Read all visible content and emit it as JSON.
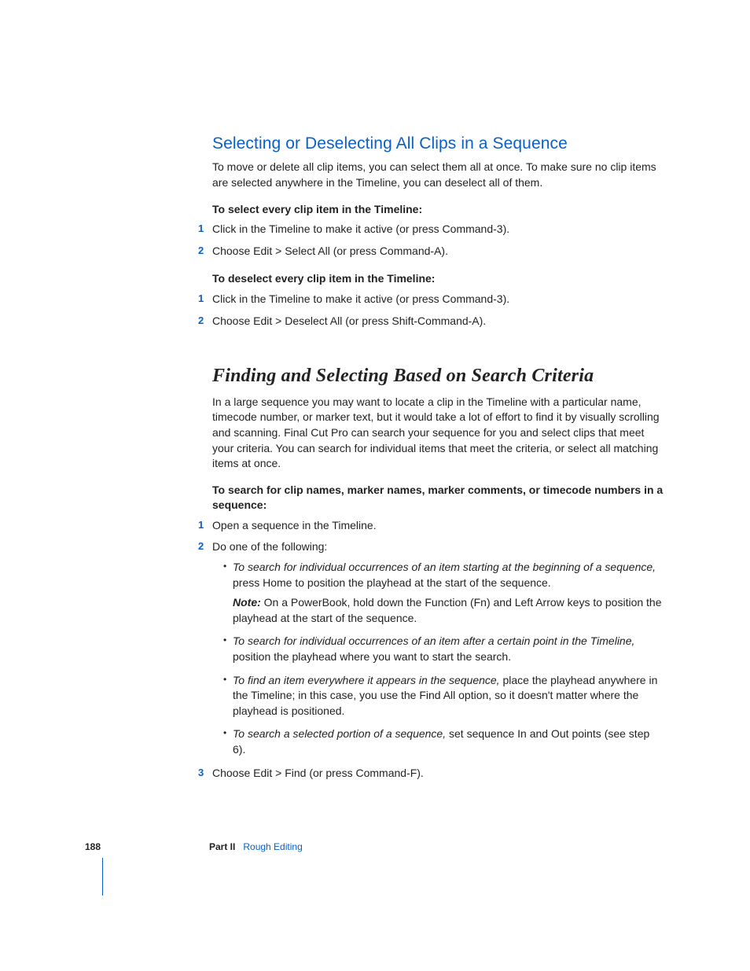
{
  "section1": {
    "heading": "Selecting or Deselecting All Clips in a Sequence",
    "intro": "To move or delete all clip items, you can select them all at once. To make sure no clip items are selected anywhere in the Timeline, you can deselect all of them.",
    "sub1": "To select every clip item in the Timeline:",
    "steps1": {
      "s1": "Click in the Timeline to make it active (or press Command-3).",
      "s2": "Choose Edit > Select All (or press Command-A)."
    },
    "sub2": "To deselect every clip item in the Timeline:",
    "steps2": {
      "s1": "Click in the Timeline to make it active (or press Command-3).",
      "s2": "Choose Edit > Deselect All (or press Shift-Command-A)."
    }
  },
  "section2": {
    "heading": "Finding and Selecting Based on Search Criteria",
    "intro": "In a large sequence you may want to locate a clip in the Timeline with a particular name, timecode number, or marker text, but it would take a lot of effort to find it by visually scrolling and scanning. Final Cut Pro can search your sequence for you and select clips that meet your criteria. You can search for individual items that meet the criteria, or select all matching items at once.",
    "sub1": "To search for clip names, marker names, marker comments, or timecode numbers in a sequence:",
    "steps": {
      "s1": "Open a sequence in the Timeline.",
      "s2": "Do one of the following:",
      "s3": "Choose Edit > Find (or press Command-F)."
    },
    "bullets": {
      "b1_i": "To search for individual occurrences of an item starting at the beginning of a sequence,",
      "b1_r": " press Home to position the playhead at the start of the sequence.",
      "b1_note_l": "Note:",
      "b1_note": "  On a PowerBook, hold down the Function (Fn) and Left Arrow keys to position the playhead at the start of the sequence.",
      "b2_i": "To search for individual occurrences of an item after a certain point in the Timeline,",
      "b2_r": " position the playhead where you want to start the search.",
      "b3_i": "To find an item everywhere it appears in the sequence,",
      "b3_r": " place the playhead anywhere in the Timeline; in this case, you use the Find All option, so it doesn't matter where the playhead is positioned.",
      "b4_i": "To search a selected portion of a sequence,",
      "b4_r": " set sequence In and Out points (see step 6)."
    }
  },
  "footer": {
    "page": "188",
    "part": "Part II",
    "title": "Rough Editing"
  },
  "nums": {
    "n1": "1",
    "n2": "2",
    "n3": "3"
  }
}
